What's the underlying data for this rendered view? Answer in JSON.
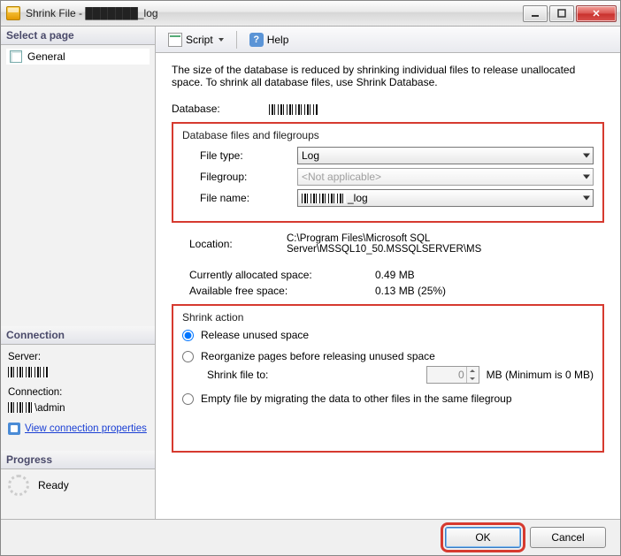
{
  "window": {
    "title": "Shrink File - ███████_log"
  },
  "sidebar": {
    "select_page": "Select a page",
    "general": "General",
    "connection_header": "Connection",
    "server_label": "Server:",
    "server_value": "██████",
    "connection_label": "Connection:",
    "connection_value": "██████\\admin",
    "view_conn_props": "View connection properties",
    "progress_header": "Progress",
    "progress_status": "Ready"
  },
  "toolbar": {
    "script": "Script",
    "help": "Help"
  },
  "main": {
    "description": "The size of the database is reduced by shrinking individual files to release unallocated space. To shrink all database files, use Shrink Database.",
    "database_label": "Database:",
    "database_value": "███████",
    "filesgroup": {
      "title": "Database files and filegroups",
      "file_type_label": "File type:",
      "file_type_value": "Log",
      "filegroup_label": "Filegroup:",
      "filegroup_value": "<Not applicable>",
      "file_name_label": "File name:",
      "file_name_value": "███████_log"
    },
    "location_label": "Location:",
    "location_value": "C:\\Program Files\\Microsoft SQL Server\\MSSQL10_50.MSSQLSERVER\\MS",
    "alloc_label": "Currently allocated space:",
    "alloc_value": "0.49 MB",
    "free_label": "Available free space:",
    "free_value": "0.13 MB (25%)",
    "shrink": {
      "title": "Shrink action",
      "opt_release": "Release unused space",
      "opt_reorg": "Reorganize pages before releasing unused space",
      "shrink_to_label": "Shrink file to:",
      "shrink_to_value": "0",
      "shrink_to_suffix": "MB (Minimum is 0 MB)",
      "opt_empty": "Empty file by migrating the data to other files in the same filegroup"
    }
  },
  "footer": {
    "ok": "OK",
    "cancel": "Cancel"
  }
}
